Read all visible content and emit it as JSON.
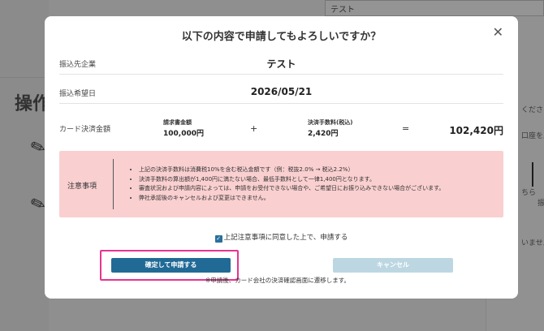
{
  "background": {
    "heading": "操作",
    "input_value": "テスト",
    "right_fragments": [
      "ください",
      "口座を入力",
      "ちら",
      "振",
      "いません"
    ]
  },
  "modal": {
    "title": "以下の内容で申請してもよろしいですか？",
    "rows": {
      "payee_label": "振込先企業",
      "payee_value": "テスト",
      "date_label": "振込希望日",
      "date_value": "2026/05/21",
      "card_label": "カード決済金額"
    },
    "calc": {
      "invoice_label": "請求書金額",
      "invoice_value": "100,000円",
      "plus": "+",
      "fee_label": "決済手数料(税込)",
      "fee_value": "2,420円",
      "equals": "=",
      "total_value": "102,420円"
    },
    "notice": {
      "label": "注意事項",
      "items": [
        "上記の決済手数料は消費税10%を含む税込金額です（例：税抜2.0% → 税込2.2%）",
        "決済手数料の算出額が1,400円に満たない場合、最低手数料として一律1,400円となります。",
        "審査状況および申請内容によっては、申請をお受付できない場合や、ご希望日にお振り込みできない場合がございます。",
        "弊社承認後のキャンセルおよび変更はできません。"
      ]
    },
    "agree_text": "上記注意事項に同意した上で、申請する",
    "confirm_label": "確定して申請する",
    "cancel_label": "キャンセル",
    "bottom_note": "※申請後、カード会社の決済確認画面に遷移します。"
  },
  "colors": {
    "primary_button": "#216a96",
    "cancel_button": "#bcd7e1",
    "notice_bg": "#f9cfd0",
    "highlight": "#e8338f"
  }
}
